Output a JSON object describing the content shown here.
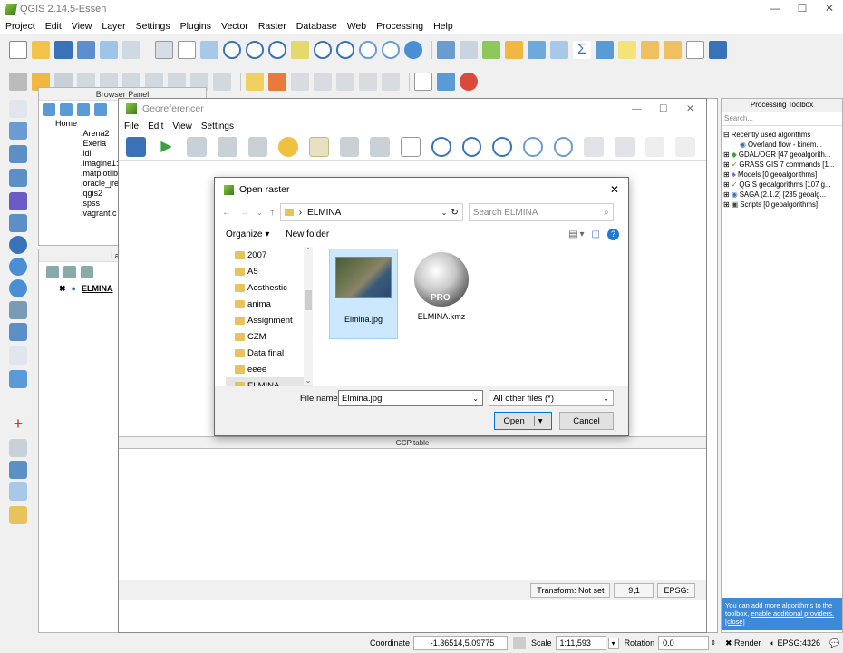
{
  "app": {
    "title": "QGIS 2.14.5-Essen"
  },
  "menubar": [
    "Project",
    "Edit",
    "View",
    "Layer",
    "Settings",
    "Plugins",
    "Vector",
    "Raster",
    "Database",
    "Web",
    "Processing",
    "Help"
  ],
  "browser_panel": {
    "title": "Browser Panel",
    "root": "Home",
    "items": [
      ".Arena2",
      ".Exeria",
      ".idl",
      ".imagine1:",
      ".matplotlib",
      ".oracle_jre",
      ".qgis2",
      ".spss",
      ".vagrant.c"
    ]
  },
  "layers_panel": {
    "title": "Layers",
    "items": [
      {
        "name": "ELMINA",
        "checked": true
      }
    ]
  },
  "georeferencer": {
    "title": "Georeferencer",
    "menu": [
      "File",
      "Edit",
      "View",
      "Settings"
    ],
    "gcp_table": {
      "title": "GCP table"
    },
    "status": {
      "transform": "Transform: Not set",
      "coords": "9,1",
      "epsg": "EPSG:"
    }
  },
  "open_raster": {
    "title": "Open raster",
    "path": [
      "ELMINA"
    ],
    "search_placeholder": "Search ELMINA",
    "organize": "Organize",
    "new_folder": "New folder",
    "nav_items": [
      "2007",
      "A5",
      "Aesthestic",
      "anima",
      "Assignment",
      "CZM",
      "Data final",
      "eeee",
      "ELMINA"
    ],
    "selected_nav": "ELMINA",
    "files": [
      {
        "name": "Elmina.jpg",
        "selected": true,
        "icon": "image-thumbnail"
      },
      {
        "name": "ELMINA.kmz",
        "selected": false,
        "icon": "google-earth-pro-icon"
      }
    ],
    "file_name_label": "File name:",
    "file_name_value": "Elmina.jpg",
    "filter": "All other files (*)",
    "open_label": "Open",
    "cancel_label": "Cancel"
  },
  "processing_toolbox": {
    "title": "Processing Toolbox",
    "search_placeholder": "Search...",
    "items": [
      "Recently used algorithms",
      "Overland flow - kinem...",
      "GDAL/OGR [47 geoalgorith...",
      "GRASS GIS 7 commands [1...",
      "Models [0 geoalgorithms]",
      "QGIS geoalgorithms [107 g...",
      "SAGA (2.1.2) [235 geoalg...",
      "Scripts [0 geoalgorithms]"
    ],
    "note": "You can add more algorithms to the toolbox,",
    "note_link": "enable additional providers.",
    "note_close": "[close]"
  },
  "statusbar": {
    "coordinate_label": "Coordinate",
    "coordinate_value": "-1.36514,5.09775",
    "scale_label": "Scale",
    "scale_value": "1:11,593",
    "rotation_label": "Rotation",
    "rotation_value": "0.0",
    "render_label": "Render",
    "epsg": "EPSG:4326"
  },
  "colors": {
    "accent": "#3c8ad8",
    "folder": "#e8c25a",
    "selection": "#cce8ff"
  }
}
